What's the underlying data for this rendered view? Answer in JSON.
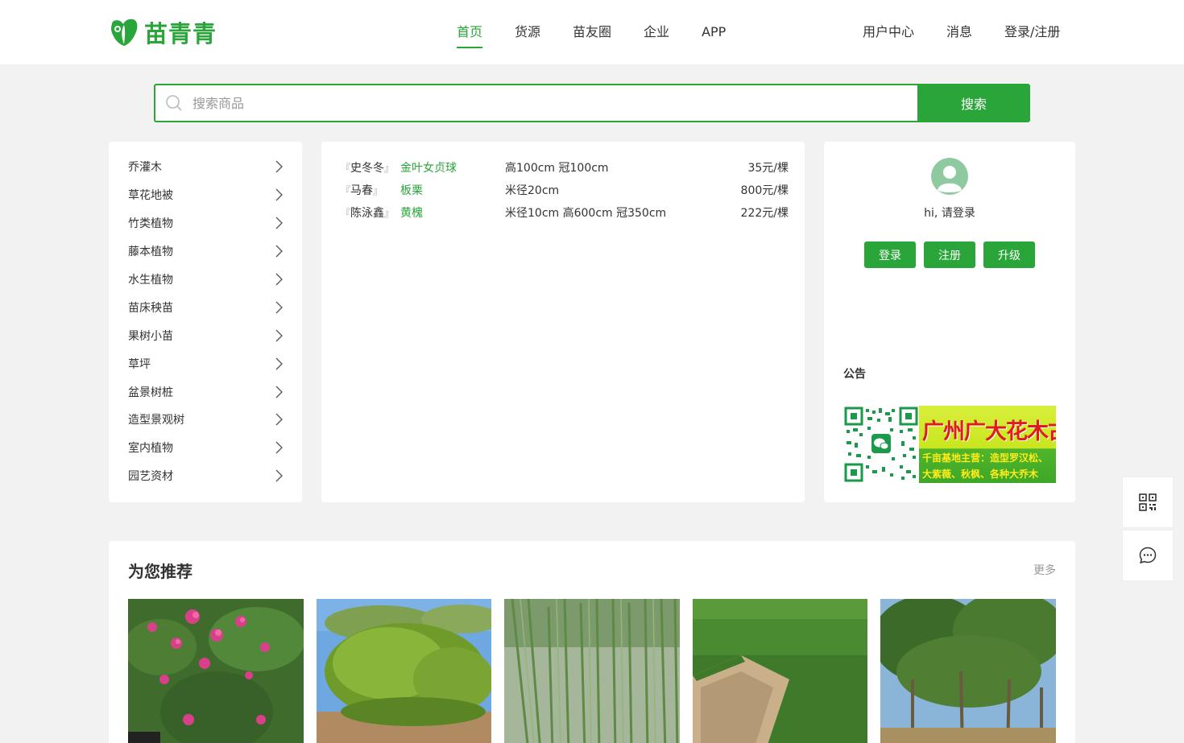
{
  "brand": {
    "name": "苗青青",
    "accent": "#2aa53a"
  },
  "nav": {
    "main": [
      {
        "label": "首页",
        "active": true
      },
      {
        "label": "货源",
        "active": false
      },
      {
        "label": "苗友圈",
        "active": false
      },
      {
        "label": "企业",
        "active": false
      },
      {
        "label": "APP",
        "active": false
      }
    ],
    "user": [
      "用户中心",
      "消息",
      "登录/注册"
    ]
  },
  "search": {
    "placeholder": "搜索商品",
    "value": "",
    "button": "搜索"
  },
  "categories": [
    "乔灌木",
    "草花地被",
    "竹类植物",
    "藤本植物",
    "水生植物",
    "苗床秧苗",
    "果树小苗",
    "草坪",
    "盆景树桩",
    "造型景观树",
    "室内植物",
    "园艺资材"
  ],
  "supply": [
    {
      "open": "『",
      "seller": "史冬冬",
      "close": "』",
      "name": "金叶女贞球",
      "spec": "高100cm 冠100cm",
      "price": "35元/棵"
    },
    {
      "open": "『",
      "seller": "马春",
      "close": "』",
      "name": "板栗",
      "spec": "米径20cm",
      "price": "800元/棵"
    },
    {
      "open": "『",
      "seller": "陈泳鑫",
      "close": "』",
      "name": "黄槐",
      "spec": "米径10cm 高600cm 冠350cm",
      "price": "222元/棵"
    }
  ],
  "user_panel": {
    "greeting": "hi, 请登录",
    "buttons": {
      "login": "登录",
      "register": "注册",
      "upgrade": "升级"
    },
    "notice_title": "公告",
    "banner": {
      "title": "广州广大花木古树园",
      "line1": "千亩基地主营：造型罗汉松、",
      "line2": "大紫薇、秋枫、各种大乔木"
    }
  },
  "side_tools": {
    "qr_icon": "qr-code-icon",
    "chat_icon": "chat-icon"
  },
  "recommend": {
    "title": "为您推荐",
    "more": "更多",
    "items": [
      {
        "image": "pink-flower-shrub"
      },
      {
        "image": "hedge-shrubs"
      },
      {
        "image": "bamboo-poles"
      },
      {
        "image": "turf-roll"
      },
      {
        "image": "tall-trees"
      }
    ]
  }
}
